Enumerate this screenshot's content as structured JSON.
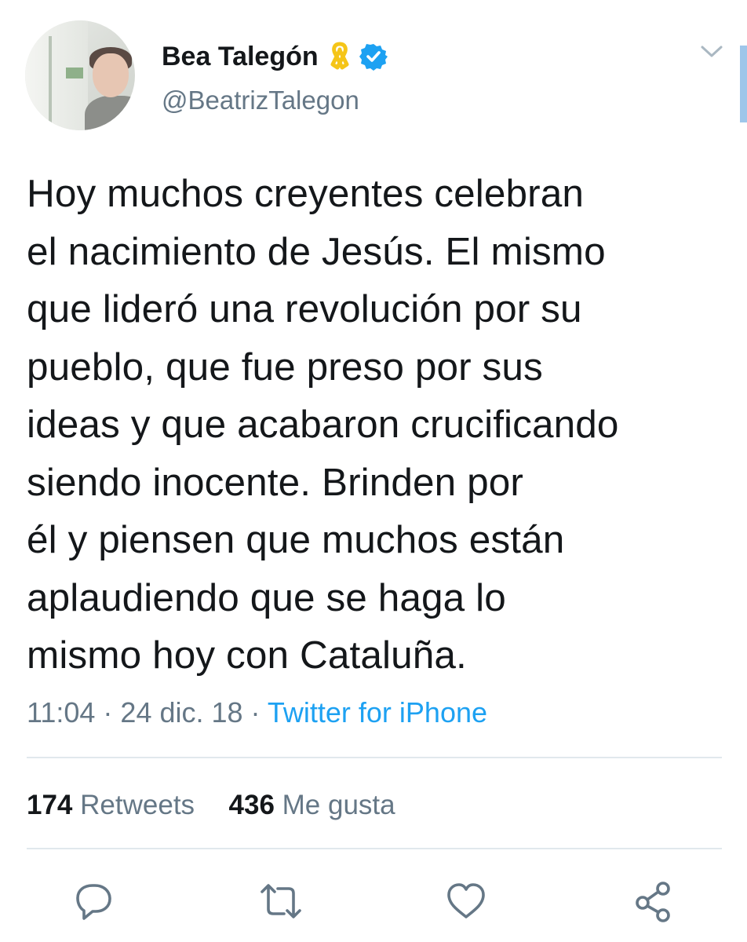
{
  "user": {
    "name": "Bea Talegón",
    "handle": "@BeatrizTalegon",
    "ribbon_icon": "yellow-ribbon-icon",
    "verified_icon": "verified-badge-icon"
  },
  "tweet": {
    "lines": [
      "Hoy muchos creyentes celebran",
      "el nacimiento de Jesús. El mismo",
      "que lideró una revolución por su",
      "pueblo, que fue preso por sus",
      "ideas y que acabaron crucificando",
      "siendo inocente. Brinden por",
      "él y piensen que muchos están",
      "aplaudiendo que se haga lo",
      "mismo hoy con Cataluña."
    ],
    "time": "11:04",
    "sep1": " · ",
    "date": "24 dic. 18",
    "sep2": " · ",
    "source": "Twitter for iPhone"
  },
  "stats": {
    "retweets_count": "174",
    "retweets_label": "Retweets",
    "likes_count": "436",
    "likes_label": "Me gusta"
  },
  "actions": [
    "reply-icon",
    "retweet-icon",
    "like-icon",
    "share-icon"
  ],
  "colors": {
    "accent": "#1da1f2",
    "secondary_text": "#657786",
    "ribbon": "#f5c518",
    "divider": "#e1e8ed"
  }
}
